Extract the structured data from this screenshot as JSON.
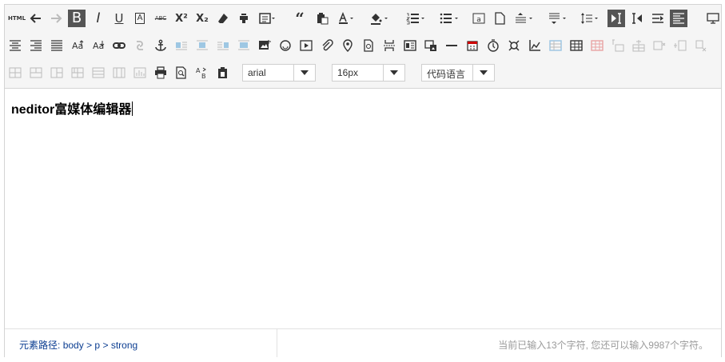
{
  "toolbar": {
    "html_label": "HTML",
    "bold_label": "B",
    "italic_label": "I",
    "underline_label": "U",
    "fontborder_label": "A",
    "strike_label": "ABC",
    "superscript_label": "X²",
    "subscript_label": "X₂",
    "font_family": "arial",
    "font_size": "16px",
    "code_language": "代码语言"
  },
  "content": {
    "text": "neditor富媒体编辑器"
  },
  "status": {
    "path_label": "元素路径:",
    "path_body": "body",
    "path_sep1": ">",
    "path_p": "p",
    "path_sep2": ">",
    "path_strong": "strong",
    "word_count": "当前已输入13个字符, 您还可以输入9987个字符。"
  },
  "colors": {
    "toolbar_bg": "#f5f5f5",
    "active_bg": "#555555",
    "path_color": "#0b3d91",
    "count_color": "#9a9a9a"
  }
}
